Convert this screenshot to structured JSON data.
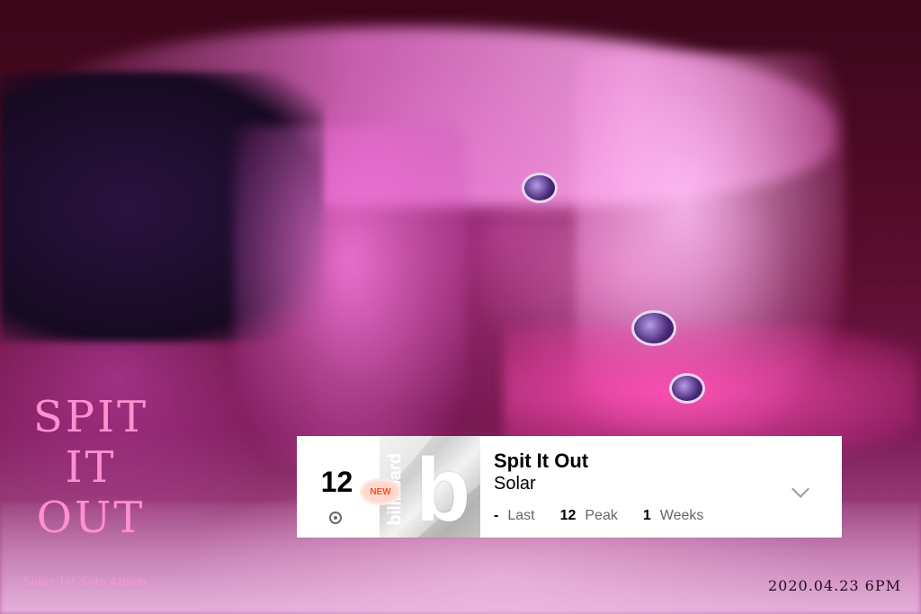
{
  "album_logo": {
    "line1": "SPIT",
    "line2": "IT",
    "line3": "OUT",
    "subtitle": "Solar 1st Solo Album"
  },
  "release_date": "2020.04.23 6PM",
  "chart_entry": {
    "rank": "12",
    "badge": "NEW",
    "cover_logo": "billboard",
    "cover_letter": "b",
    "title": "Spit It Out",
    "artist": "Solar",
    "last_week": "-",
    "last_label": "Last",
    "peak": "12",
    "peak_label": "Peak",
    "weeks": "1",
    "weeks_label": "Weeks",
    "status_icon": "target-icon",
    "expand_icon": "chevron-down-icon"
  }
}
